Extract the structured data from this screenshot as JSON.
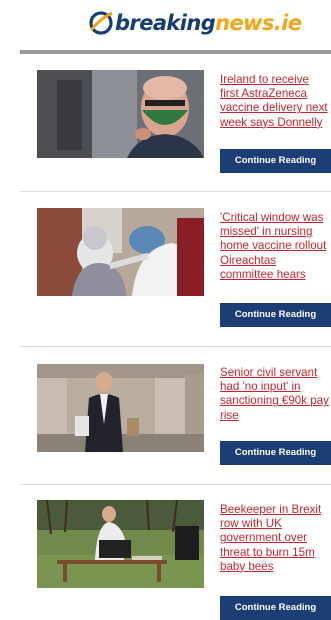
{
  "brand": {
    "logo_part1": "breaking",
    "logo_part2": "news.ie",
    "colors": {
      "navy": "#143d73",
      "orange": "#f2a516",
      "headline": "#c3262f",
      "button": "#1d3e75"
    }
  },
  "articles": [
    {
      "headline": "Ireland to receive\nfirst AstraZeneca\nvaccine delivery next\nweek says Donnelly",
      "button": "Continue Reading",
      "image": "man-wearing-green-face-mask"
    },
    {
      "headline": "'Critical window was\nmissed' in nursing\nhome vaccine rollout\nOireachtas\ncommittee hears",
      "button": "Continue Reading",
      "image": "elderly-woman-receiving-vaccine"
    },
    {
      "headline": "Senior civil servant\nhad 'no input' in\nsanctioning €90k pay\nrise",
      "button": "Continue Reading",
      "image": "man-in-suit-walking-past-building"
    },
    {
      "headline": "Beekeeper in Brexit\nrow with UK\ngovernment over\nthreat to burn 15m\nbaby bees",
      "button": "Continue Reading",
      "image": "beekeeper-with-hives-in-field"
    }
  ]
}
